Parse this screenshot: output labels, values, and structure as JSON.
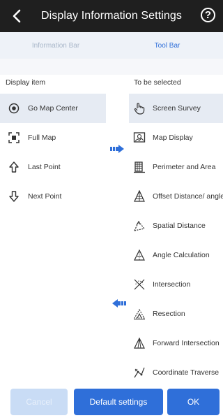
{
  "header": {
    "title": "Display Information Settings",
    "help_symbol": "?"
  },
  "tabs": [
    {
      "label": "Information Bar",
      "active": false
    },
    {
      "label": "Tool Bar",
      "active": true
    }
  ],
  "left": {
    "heading": "Display item",
    "items": [
      {
        "label": "Go Map Center",
        "icon": "target-icon",
        "selected": true
      },
      {
        "label": "Full Map",
        "icon": "full-map-icon",
        "selected": false
      },
      {
        "label": "Last Point",
        "icon": "up-arrow-icon",
        "selected": false
      },
      {
        "label": "Next Point",
        "icon": "down-arrow-icon",
        "selected": false
      }
    ]
  },
  "right": {
    "heading": "To be selected",
    "items": [
      {
        "label": "Screen Survey",
        "icon": "hand-tap-icon",
        "selected": true
      },
      {
        "label": "Map Display",
        "icon": "map-display-icon",
        "selected": false
      },
      {
        "label": "Perimeter and Area",
        "icon": "area-icon",
        "selected": false
      },
      {
        "label": "Offset Distance/ angle",
        "icon": "offset-icon",
        "selected": false
      },
      {
        "label": "Spatial Distance",
        "icon": "spatial-distance-icon",
        "selected": false
      },
      {
        "label": "Angle Calculation",
        "icon": "angle-icon",
        "selected": false
      },
      {
        "label": "Intersection",
        "icon": "intersection-icon",
        "selected": false
      },
      {
        "label": "Resection",
        "icon": "resection-icon",
        "selected": false
      },
      {
        "label": "Forward Intersection",
        "icon": "forward-intersection-icon",
        "selected": false
      },
      {
        "label": "Coordinate Traverse",
        "icon": "coordinate-traverse-icon",
        "selected": false
      }
    ]
  },
  "footer": {
    "cancel": "Cancel",
    "default": "Default settings",
    "ok": "OK"
  },
  "colors": {
    "accent": "#2f6fd9",
    "header_bg": "#1f1f1f",
    "selected_bg": "#e6ebf3"
  }
}
